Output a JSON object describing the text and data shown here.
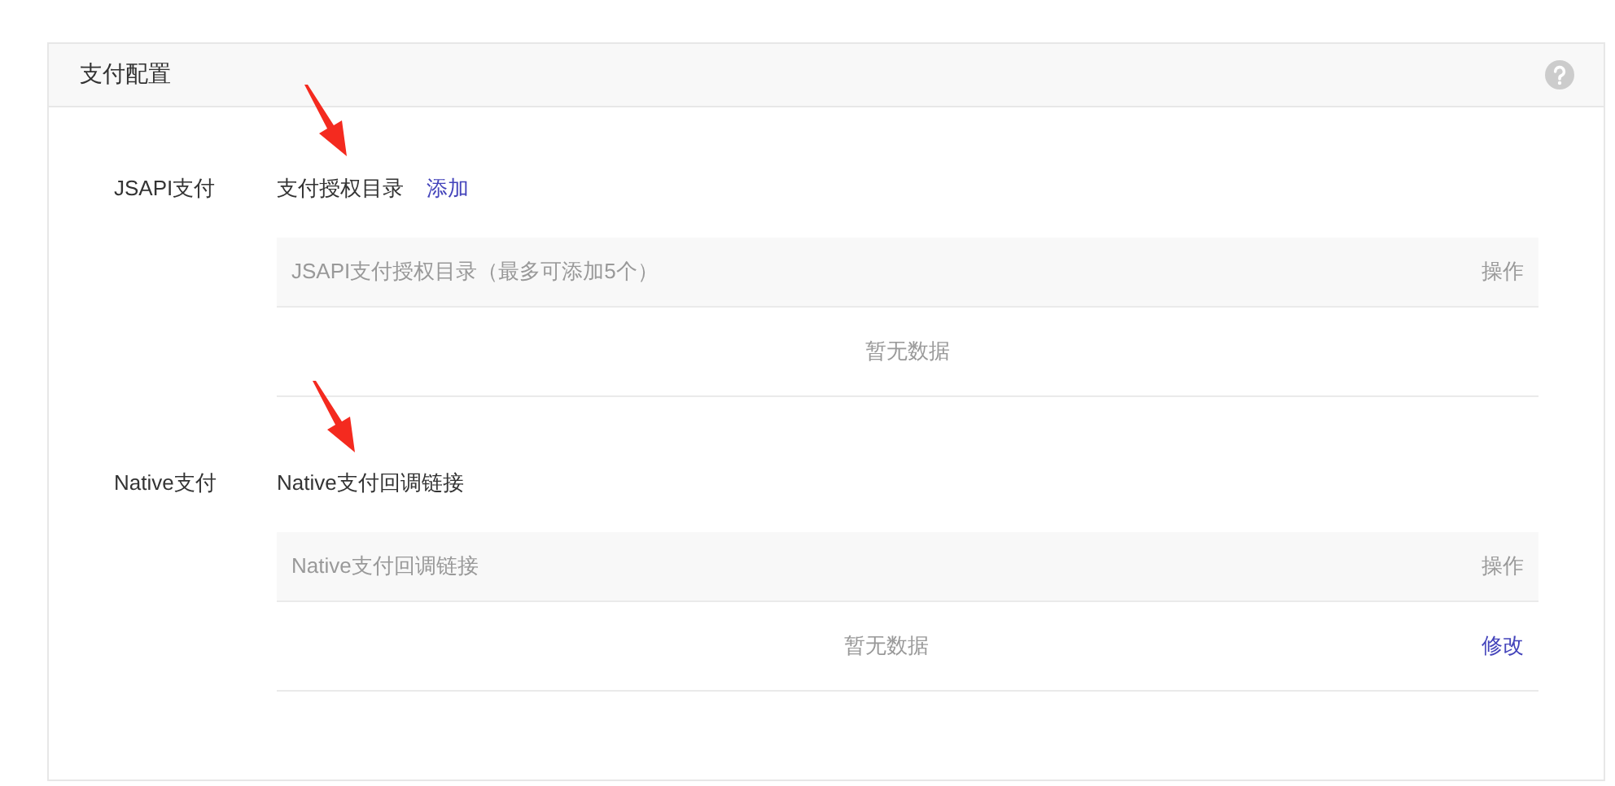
{
  "panel": {
    "title": "支付配置"
  },
  "sections": [
    {
      "label": "JSAPI支付",
      "heading": "支付授权目录",
      "link": "添加",
      "table": {
        "columns": [
          "JSAPI支付授权目录（最多可添加5个）",
          "操作"
        ],
        "empty_text": "暂无数据"
      }
    },
    {
      "label": "Native支付",
      "heading": "Native支付回调链接",
      "table": {
        "columns": [
          "Native支付回调链接",
          "操作"
        ],
        "empty_text": "暂无数据",
        "row_action": "修改"
      }
    }
  ]
}
